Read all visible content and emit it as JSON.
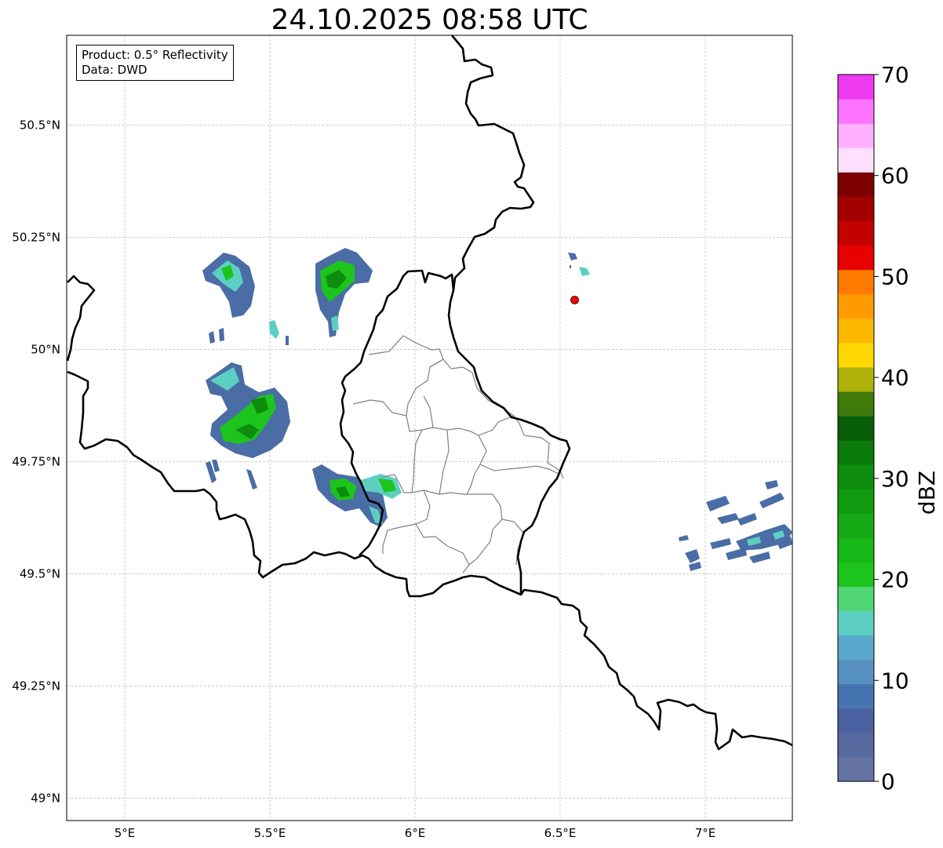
{
  "title": "24.10.2025 08:58 UTC",
  "info_box": {
    "product": "Product: 0.5° Reflectivity",
    "data": "Data: DWD"
  },
  "map": {
    "lon_range": [
      4.8,
      7.3
    ],
    "lat_range": [
      48.95,
      50.7
    ],
    "lon_ticks": [
      {
        "value": 5.0,
        "label": "5°E"
      },
      {
        "value": 5.5,
        "label": "5.5°E"
      },
      {
        "value": 6.0,
        "label": "6°E"
      },
      {
        "value": 6.5,
        "label": "6.5°E"
      },
      {
        "value": 7.0,
        "label": "7°E"
      }
    ],
    "lat_ticks": [
      {
        "value": 49.0,
        "label": "49°N"
      },
      {
        "value": 49.25,
        "label": "49.25°N"
      },
      {
        "value": 49.5,
        "label": "49.5°N"
      },
      {
        "value": 49.75,
        "label": "49.75°N"
      },
      {
        "value": 50.0,
        "label": "50°N"
      },
      {
        "value": 50.25,
        "label": "50.25°N"
      },
      {
        "value": 50.5,
        "label": "50.5°N"
      }
    ],
    "grid": true,
    "radar_site": {
      "lon": 6.55,
      "lat": 50.11,
      "color": "#ff0000"
    }
  },
  "colorbar": {
    "label": "dBZ",
    "min": 0,
    "max": 70,
    "ticks": [
      0,
      10,
      20,
      30,
      40,
      50,
      60,
      70
    ],
    "colors": [
      "#6473a4",
      "#566aa0",
      "#4b62a1",
      "#4674b0",
      "#5791c1",
      "#5aa9cc",
      "#5ccfc2",
      "#52d776",
      "#1cc41c",
      "#16b716",
      "#14a914",
      "#0f9a0f",
      "#0d8c0d",
      "#0a7a0a",
      "#085e08",
      "#3f7a0a",
      "#adb10a",
      "#ffd700",
      "#ffb800",
      "#ff9a00",
      "#ff7a00",
      "#e60000",
      "#c40000",
      "#a30000",
      "#7d0000",
      "#ffe0ff",
      "#ffb0ff",
      "#ff74ff",
      "#ee3af0"
    ]
  },
  "legend_colors": {
    "weak": "#4a6da6",
    "light": "#5ccfc2",
    "moderate": "#1cc41c",
    "strong": "#0d8c0d"
  }
}
